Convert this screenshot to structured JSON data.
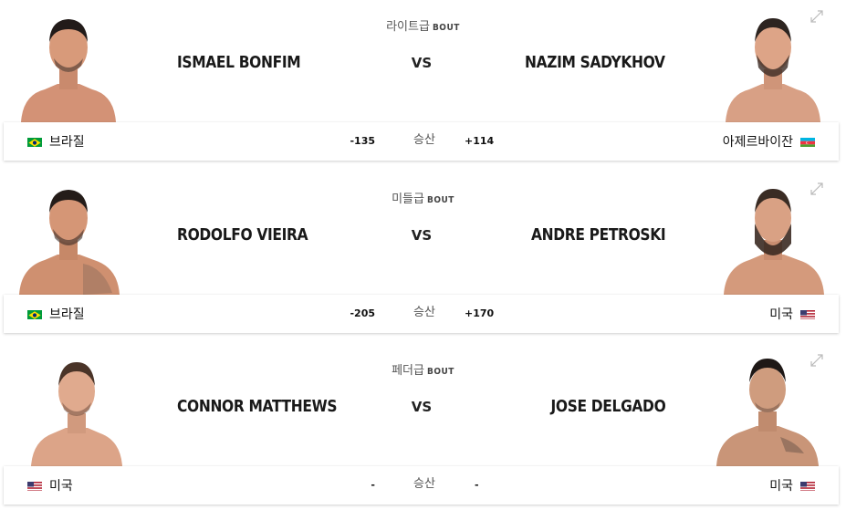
{
  "bouts": [
    {
      "weight_class": "라이트급",
      "bout_word": "BOUT",
      "red": {
        "name": "ISMAEL BONFIM",
        "country": "브라질",
        "flag": "brazil-flag",
        "odds": "-135"
      },
      "blue": {
        "name": "NAZIM SADYKHOV",
        "country": "아제르바이잔",
        "flag": "azerbaijan-flag",
        "odds": "+114"
      },
      "vs": "VS",
      "odds_label": "승산"
    },
    {
      "weight_class": "미들급",
      "bout_word": "BOUT",
      "red": {
        "name": "RODOLFO VIEIRA",
        "country": "브라질",
        "flag": "brazil-flag",
        "odds": "-205"
      },
      "blue": {
        "name": "ANDRE PETROSKI",
        "country": "미국",
        "flag": "usa-flag",
        "odds": "+170"
      },
      "vs": "VS",
      "odds_label": "승산"
    },
    {
      "weight_class": "페더급",
      "bout_word": "BOUT",
      "red": {
        "name": "CONNOR MATTHEWS",
        "country": "미국",
        "flag": "usa-flag",
        "odds": "-"
      },
      "blue": {
        "name": "JOSE DELGADO",
        "country": "미국",
        "flag": "usa-flag",
        "odds": "-"
      },
      "vs": "VS",
      "odds_label": "승산"
    }
  ],
  "colors": {
    "skin": "#d89a7a",
    "hair": "#2a2220",
    "background": "#ffffff",
    "text": "#191919"
  }
}
